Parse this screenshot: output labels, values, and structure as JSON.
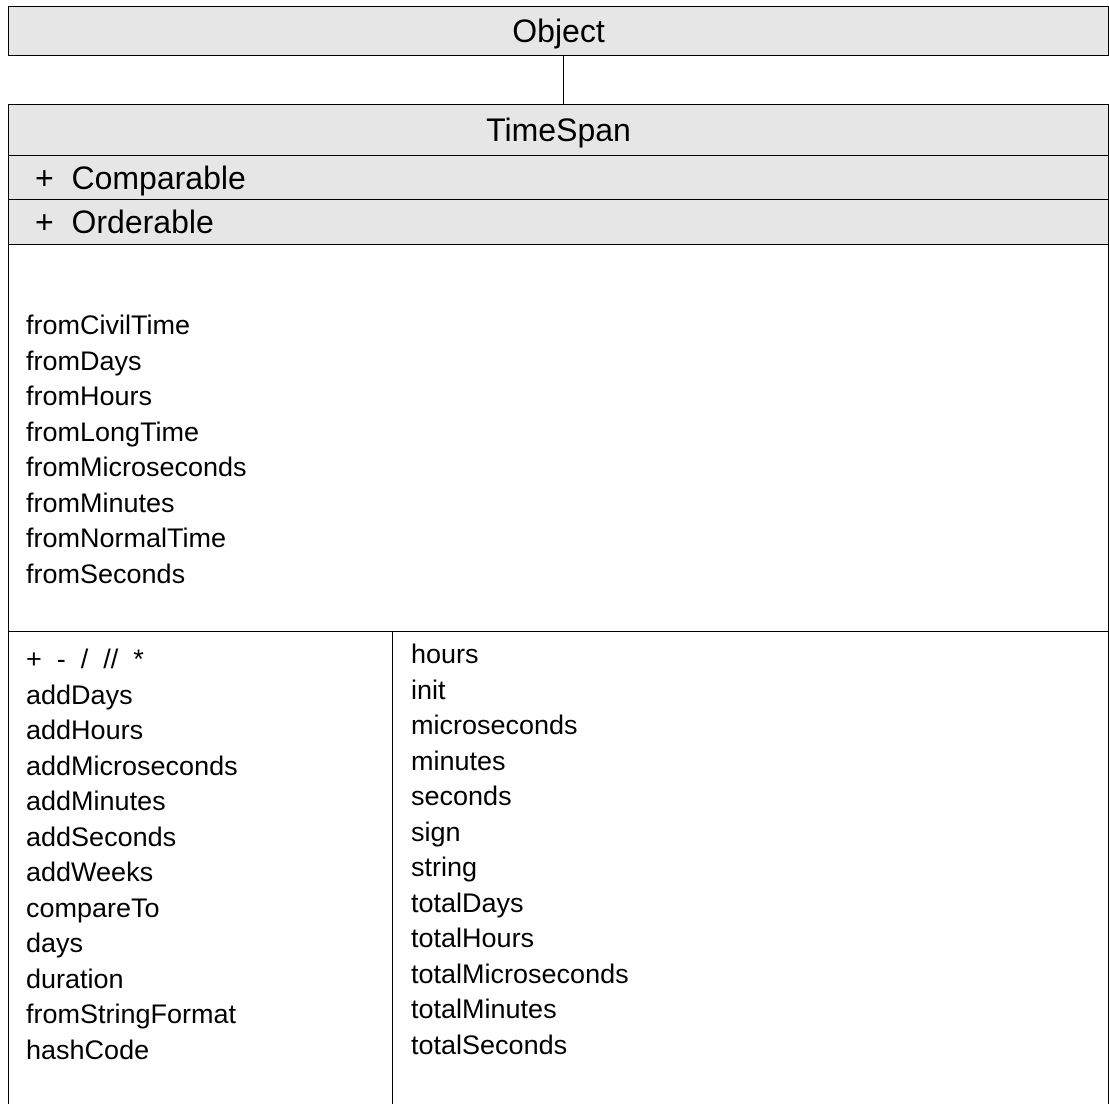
{
  "superclass": {
    "name": "Object"
  },
  "class": {
    "name": "TimeSpan",
    "interfaces": [
      "+  Comparable",
      "+  Orderable"
    ],
    "static_methods": [
      "fromCivilTime",
      "fromDays",
      "fromHours",
      "fromLongTime",
      "fromMicroseconds",
      "fromMinutes",
      "fromNormalTime",
      "fromSeconds"
    ],
    "instance_methods_col1": [
      "+  -  /  //  *",
      "addDays",
      "addHours",
      "addMicroseconds",
      "addMinutes",
      "addSeconds",
      "addWeeks",
      "compareTo",
      "days",
      "duration",
      "fromStringFormat",
      "hashCode"
    ],
    "instance_methods_col2": [
      "hours",
      "init",
      "microseconds",
      "minutes",
      "seconds",
      "sign",
      "string",
      "totalDays",
      "totalHours",
      "totalMicroseconds",
      "totalMinutes",
      "totalSeconds"
    ]
  },
  "colors": {
    "header_fill": "#e6e6e6",
    "border": "#000000",
    "background": "#ffffff"
  }
}
